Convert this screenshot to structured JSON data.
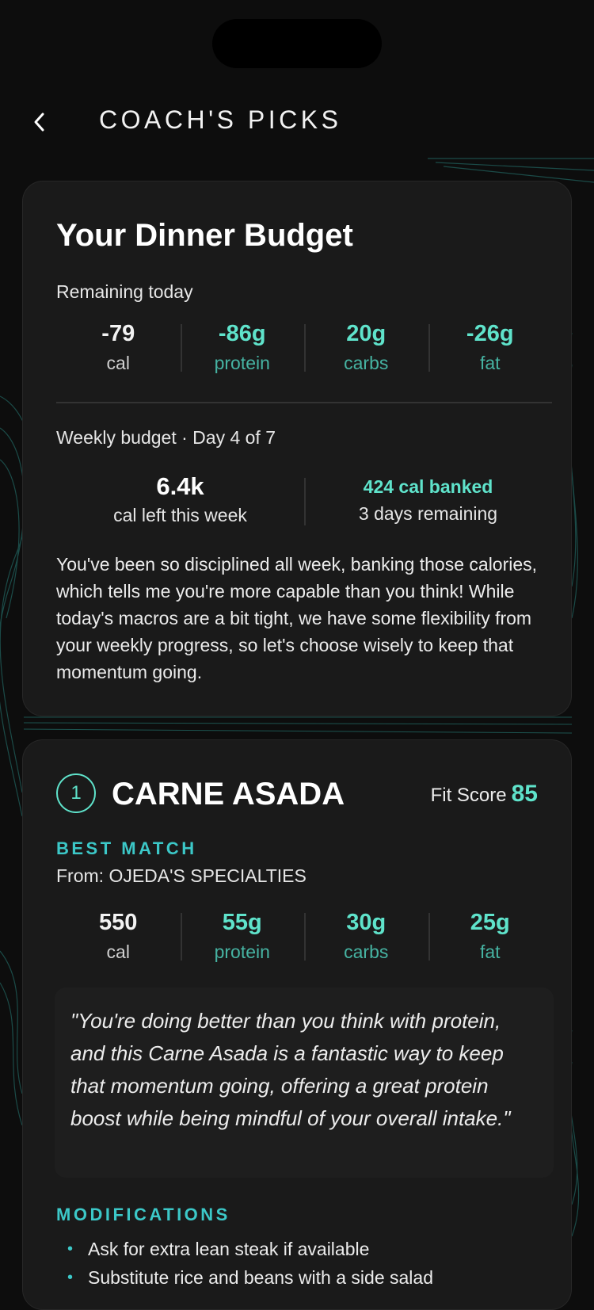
{
  "header": {
    "title": "COACH'S PICKS",
    "back_icon": "chevron-left-icon"
  },
  "budget": {
    "title": "Your Dinner Budget",
    "remaining_label": "Remaining today",
    "macros": [
      {
        "value": "-79",
        "unit": "cal"
      },
      {
        "value": "-86g",
        "unit": "protein"
      },
      {
        "value": "20g",
        "unit": "carbs"
      },
      {
        "value": "-26g",
        "unit": "fat"
      }
    ],
    "weekly_label": "Weekly budget · Day 4 of 7",
    "weekly_left_value": "6.4k",
    "weekly_left_label": "cal left this week",
    "banked": "424 cal banked",
    "days_remaining": "3 days remaining",
    "message": "You've been so disciplined all week, banking those calories, which tells me you're more capable than you think! While today's macros are a bit tight, we have some flexibility from your weekly progress, so let's choose wisely to keep that momentum going."
  },
  "pick": {
    "rank": "1",
    "name": "CARNE ASADA",
    "fit_label": "Fit Score",
    "fit_score": "85",
    "badge": "BEST MATCH",
    "from": "From: OJEDA'S SPECIALTIES",
    "macros": [
      {
        "value": "550",
        "unit": "cal"
      },
      {
        "value": "55g",
        "unit": "protein"
      },
      {
        "value": "30g",
        "unit": "carbs"
      },
      {
        "value": "25g",
        "unit": "fat"
      }
    ],
    "quote": "\"You're doing better than you think with protein, and this Carne Asada is a fantastic way to keep that momentum going, offering a great protein boost while being mindful of your overall intake.\"",
    "modifications_label": "MODIFICATIONS",
    "modifications": [
      "Ask for extra lean steak if available",
      "Substitute rice and beans with a side salad"
    ]
  },
  "colors": {
    "accent": "#5fe3cb",
    "accent_dim": "#46b3a2",
    "label_accent": "#3cc8c8",
    "background": "#0d0d0d",
    "card": "#1a1a1a"
  }
}
